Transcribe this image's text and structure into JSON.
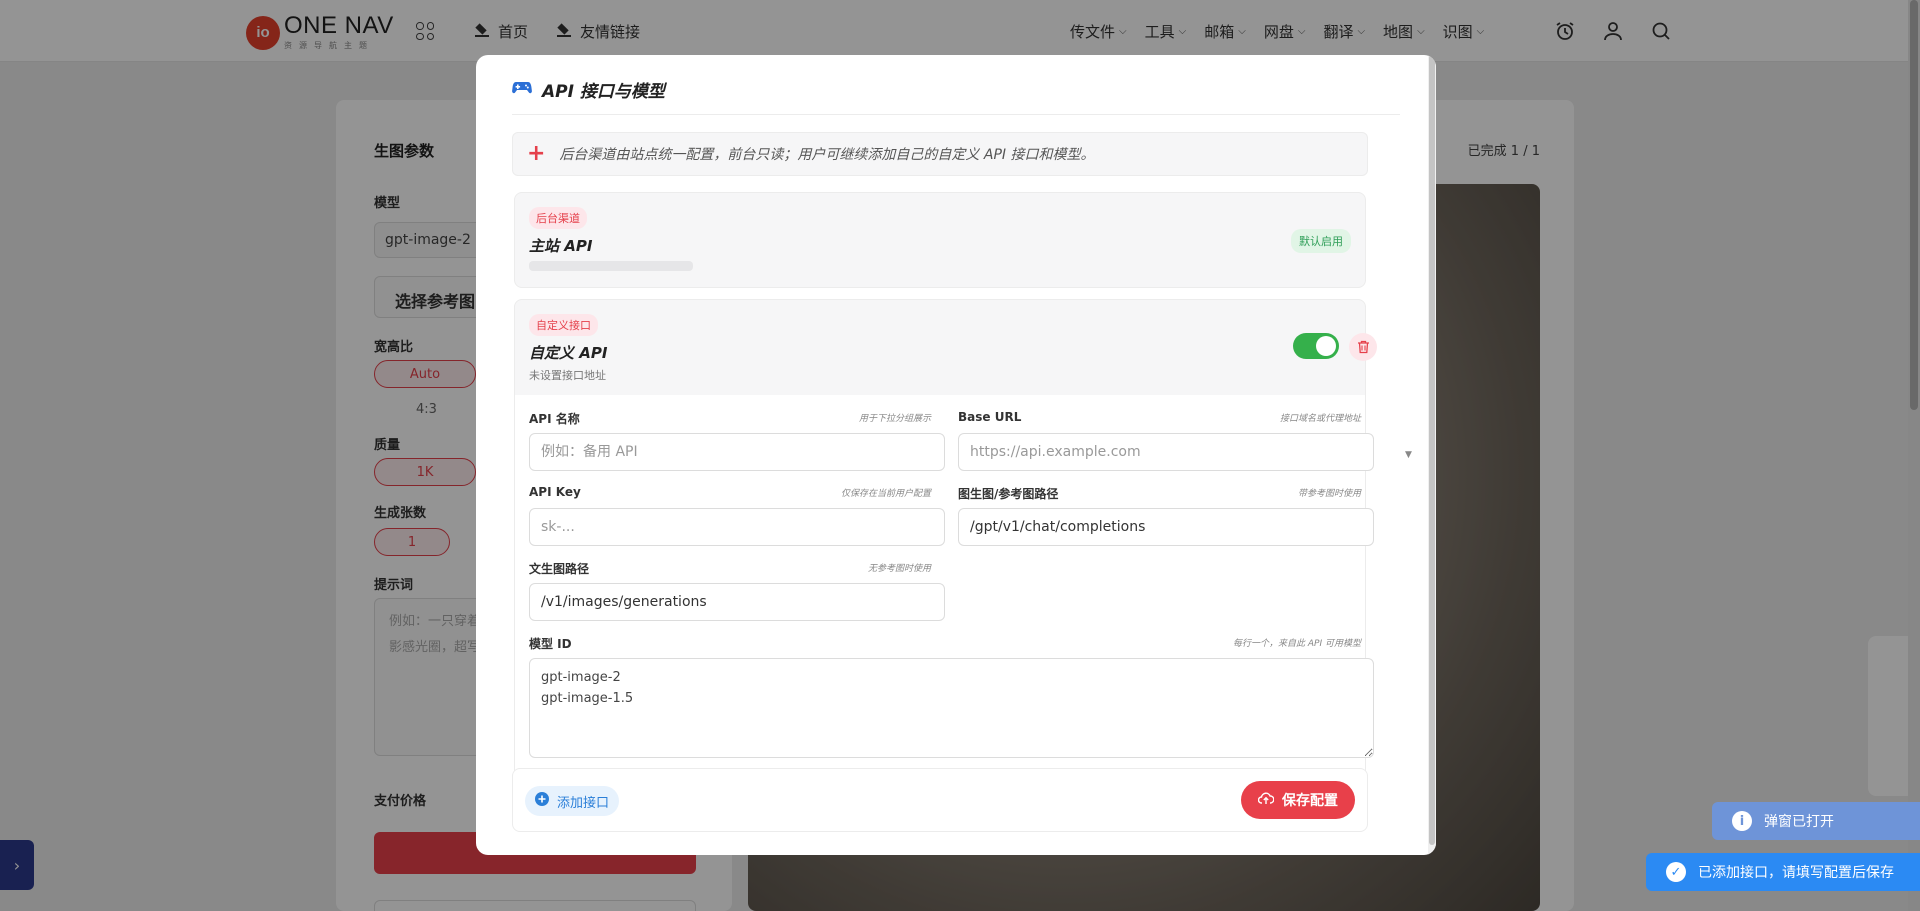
{
  "brand": {
    "logo_mark": "io",
    "name": "ONE NAV",
    "tagline": "资源导航主题"
  },
  "nav": {
    "left_items": [
      {
        "label": "首页",
        "icon": "layers-icon"
      },
      {
        "label": "友情链接",
        "icon": "layers-icon"
      }
    ],
    "right_items": [
      {
        "label": "传文件"
      },
      {
        "label": "工具"
      },
      {
        "label": "邮箱"
      },
      {
        "label": "网盘"
      },
      {
        "label": "翻译"
      },
      {
        "label": "地图"
      },
      {
        "label": "识图"
      }
    ],
    "icons": [
      "alarm-clock-icon",
      "user-icon",
      "search-icon"
    ]
  },
  "left_panel": {
    "title": "生图参数",
    "model_label": "模型",
    "model_value": "gpt-image-2",
    "reference_button": "选择参考图",
    "aspect_label": "宽高比",
    "aspect_selected": "Auto",
    "aspect_other": "4:3",
    "quality_label": "质量",
    "quality_selected": "1K",
    "count_label": "生成张数",
    "count_selected": "1",
    "prompt_label": "提示词",
    "prompt_placeholder_line1": "例如：一只穿着",
    "prompt_placeholder_line2": "影感光圈，超写",
    "price_label": "支付价格"
  },
  "right_panel": {
    "status": "已完成 1 / 1"
  },
  "modal": {
    "title": "API 接口与模型",
    "title_icon": "gamepad-icon",
    "notice": "后台渠道由站点统一配置，前台只读；用户可继续添加自己的自定义 API 接口和模型。",
    "backend_card": {
      "badge": "后台渠道",
      "name": "主站 API",
      "status_badge": "默认启用"
    },
    "custom_card": {
      "badge": "自定义接口",
      "name": "自定义 API",
      "subtitle": "未设置接口地址",
      "enabled": true
    },
    "form": {
      "api_name": {
        "label": "API 名称",
        "hint": "用于下拉分组展示",
        "placeholder": "例如：备用 API",
        "value": ""
      },
      "base_url": {
        "label": "Base URL",
        "hint": "接口域名或代理地址",
        "placeholder": "https://api.example.com",
        "value": ""
      },
      "api_key": {
        "label": "API Key",
        "hint": "仅保存在当前用户配置",
        "placeholder": "sk-...",
        "value": ""
      },
      "img2img_path": {
        "label": "图生图/参考图路径",
        "hint": "带参考图时使用",
        "value": "/gpt/v1/chat/completions"
      },
      "txt2img_path": {
        "label": "文生图路径",
        "hint": "无参考图时使用",
        "value": "/v1/images/generations"
      },
      "model_ids": {
        "label": "模型 ID",
        "hint": "每行一个，来自此 API 可用模型",
        "value": "gpt-image-2\ngpt-image-1.5"
      }
    },
    "footer": {
      "add_button": "添加接口",
      "save_button": "保存配置"
    }
  },
  "toasts": [
    {
      "text": "弹窗已打开",
      "icon": "info-icon"
    },
    {
      "text": "已添加接口，请填写配置后保存",
      "icon": "check-circle-icon"
    }
  ],
  "colors": {
    "accent_red": "#e8404a",
    "toggle_green": "#35b04b",
    "info_blue": "#2b8af3",
    "sidebar_navy": "#2b3a8c"
  }
}
